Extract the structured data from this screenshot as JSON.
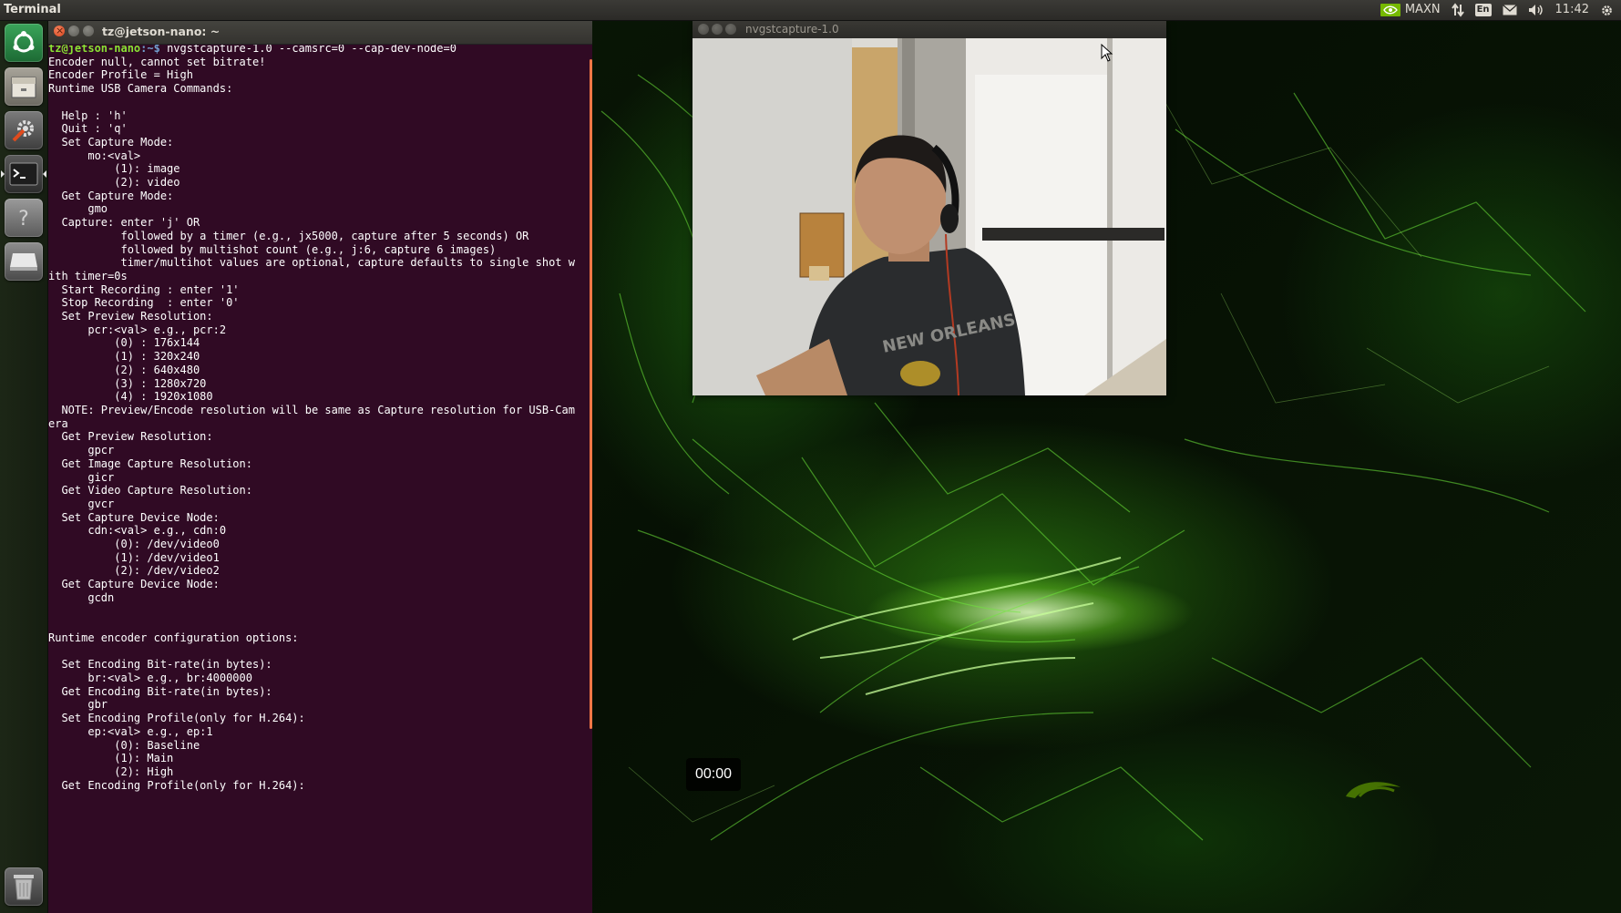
{
  "panel": {
    "app_name": "Terminal",
    "nvidia_mode": "MAXN",
    "keyboard_layout": "En",
    "clock": "11:42"
  },
  "launcher": {
    "items": [
      {
        "name": "ubuntu-dash-icon"
      },
      {
        "name": "files-icon"
      },
      {
        "name": "system-settings-icon"
      },
      {
        "name": "terminal-icon"
      },
      {
        "name": "help-icon"
      },
      {
        "name": "drive-icon"
      },
      {
        "name": "trash-icon"
      }
    ]
  },
  "terminal": {
    "window_title": "tz@jetson-nano: ~",
    "prompt_user": "tz@jetson-nano",
    "prompt_path": ":~$",
    "command": " nvgstcapture-1.0 --camsrc=0 --cap-dev-node=0",
    "output": "Encoder null, cannot set bitrate!\nEncoder Profile = High\nRuntime USB Camera Commands:\n\n  Help : 'h'\n  Quit : 'q'\n  Set Capture Mode:\n      mo:<val>\n          (1): image\n          (2): video\n  Get Capture Mode:\n      gmo\n  Capture: enter 'j' OR\n           followed by a timer (e.g., jx5000, capture after 5 seconds) OR\n           followed by multishot count (e.g., j:6, capture 6 images)\n           timer/multihot values are optional, capture defaults to single shot w\nith timer=0s\n  Start Recording : enter '1'\n  Stop Recording  : enter '0'\n  Set Preview Resolution:\n      pcr:<val> e.g., pcr:2\n          (0) : 176x144\n          (1) : 320x240\n          (2) : 640x480\n          (3) : 1280x720\n          (4) : 1920x1080\n  NOTE: Preview/Encode resolution will be same as Capture resolution for USB-Cam\nera\n  Get Preview Resolution:\n      gpcr\n  Get Image Capture Resolution:\n      gicr\n  Get Video Capture Resolution:\n      gvcr\n  Set Capture Device Node:\n      cdn:<val> e.g., cdn:0\n          (0): /dev/video0\n          (1): /dev/video1\n          (2): /dev/video2\n  Get Capture Device Node:\n      gcdn\n\n\nRuntime encoder configuration options:\n\n  Set Encoding Bit-rate(in bytes):\n      br:<val> e.g., br:4000000\n  Get Encoding Bit-rate(in bytes):\n      gbr\n  Set Encoding Profile(only for H.264):\n      ep:<val> e.g., ep:1\n          (0): Baseline\n          (1): Main\n          (2): High\n  Get Encoding Profile(only for H.264):"
  },
  "capture_window": {
    "window_title": "nvgstcapture-1.0",
    "timer": "00:00"
  },
  "colors": {
    "terminal_bg": "#300a24",
    "prompt_user": "#8ae234",
    "prompt_path": "#729fcf",
    "accent_orange": "#f07746",
    "nvidia_green": "#76b900"
  }
}
